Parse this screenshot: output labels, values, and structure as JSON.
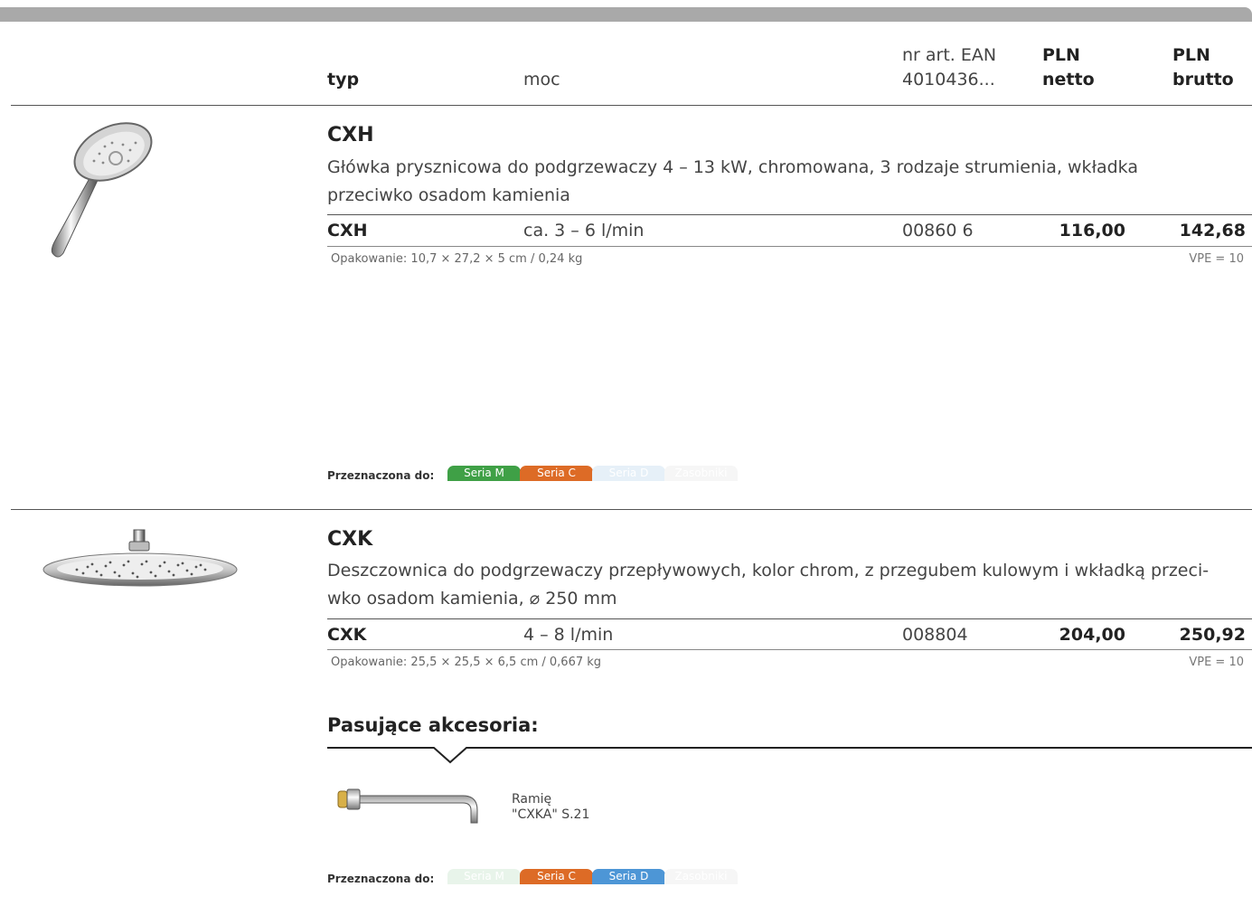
{
  "header": {
    "typ": "typ",
    "moc": "moc",
    "ean_line1": "nr art. EAN",
    "ean_line2": "4010436...",
    "netto_line1": "PLN",
    "netto_line2": "netto",
    "brutto_line1": "PLN",
    "brutto_line2": "brutto"
  },
  "products": [
    {
      "title": "CXH",
      "description_line1": "Główka prysznicowa do podgrzewaczy 4 – 13 kW, chromowana, 3 rodzaje strumienia, wkładka",
      "description_line2": "przeciwko osadom kamienia",
      "typ": "CXH",
      "moc": "ca. 3 – 6 l/min",
      "ean": "00860 6",
      "netto": "116,00",
      "brutto": "142,68",
      "packaging": "Opakowanie: 10,7 × 27,2 × 5 cm / 0,24 kg",
      "vpe": "VPE = 10",
      "destination_label": "Przeznaczona do:",
      "tags": [
        {
          "label": "Seria M",
          "color": "#3fa046",
          "active": true
        },
        {
          "label": "Seria C",
          "color": "#dd6b26",
          "active": true
        },
        {
          "label": "Seria D",
          "color": "#e6f0f8",
          "active": false
        },
        {
          "label": "Zasobniki",
          "color": "#f6f6f6",
          "active": false
        }
      ]
    },
    {
      "title": "CXK",
      "description_line1": "Deszczownica do podgrzewaczy przepływowych, kolor chrom, z przegubem kulowym i wkładką przeci-",
      "description_line2": "wko osadom kamienia, ⌀ 250 mm",
      "typ": "CXK",
      "moc": "4 – 8 l/min",
      "ean": "008804",
      "netto": "204,00",
      "brutto": "250,92",
      "packaging": "Opakowanie: 25,5 × 25,5 × 6,5 cm / 0,667 kg",
      "vpe": "VPE = 10",
      "destination_label": "Przeznaczona do:",
      "tags": [
        {
          "label": "Seria M",
          "color": "#e8f4ea",
          "active": false
        },
        {
          "label": "Seria C",
          "color": "#dd6b26",
          "active": true
        },
        {
          "label": "Seria D",
          "color": "#4d96d6",
          "active": true
        },
        {
          "label": "Zasobniki",
          "color": "#f6f6f6",
          "active": false
        }
      ]
    }
  ],
  "accessories": {
    "title": "Pasujące akcesoria:",
    "item_line1": "Ramię",
    "item_line2": "\"CXKA\" S.21"
  }
}
